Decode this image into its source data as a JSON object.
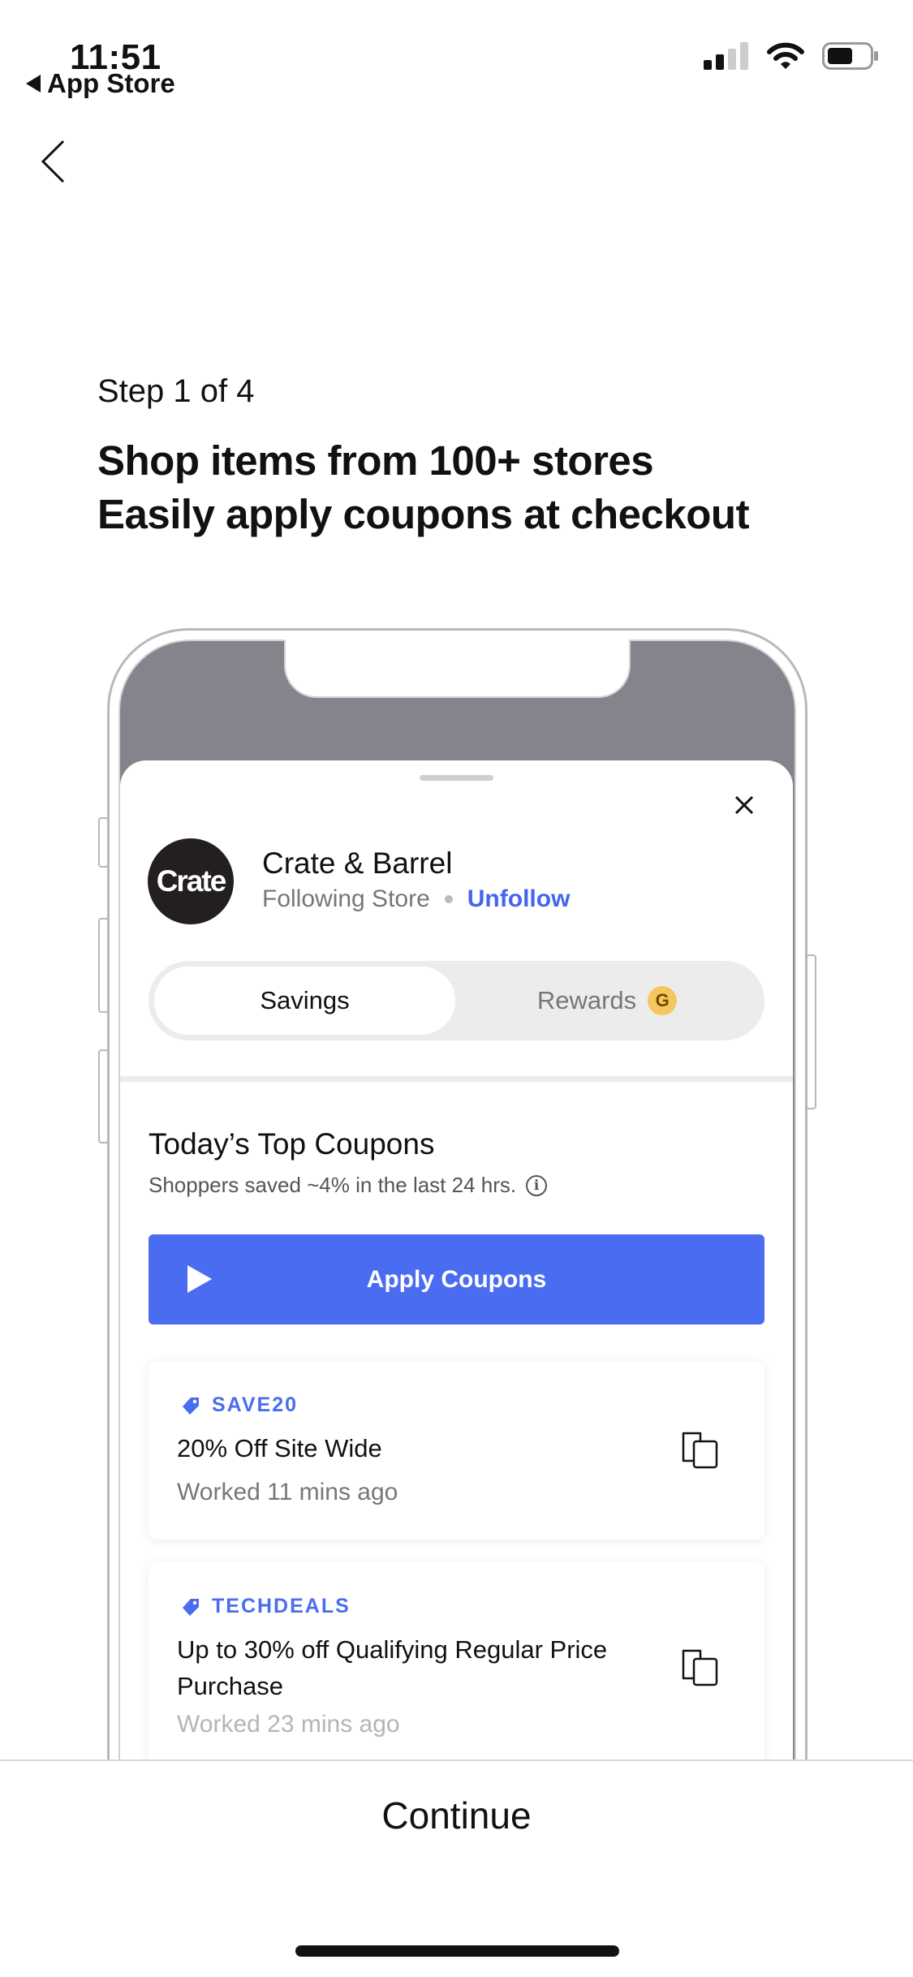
{
  "status_bar": {
    "time": "11:51",
    "back_app": "App Store",
    "battery_level": 0.55
  },
  "nav": {
    "back_icon": "chevron-left-icon"
  },
  "onboarding": {
    "step": "Step 1 of 4",
    "headline": [
      "Shop items from 100+ stores",
      "Easily apply coupons at checkout"
    ],
    "continue_label": "Continue"
  },
  "mock": {
    "store": {
      "logo_text": "Crate",
      "name": "Crate & Barrel",
      "status": "Following Store",
      "action": "Unfollow"
    },
    "tabs": [
      {
        "label": "Savings",
        "selected": true
      },
      {
        "label": "Rewards",
        "badge": "G"
      }
    ],
    "section": {
      "title": "Today’s Top Coupons",
      "subtitle": "Shoppers saved ~4% in the last 24 hrs.",
      "info": "i"
    },
    "apply_label": "Apply Coupons",
    "coupons": [
      {
        "code": "SAVE20",
        "title": "20% Off Site Wide",
        "meta": "Worked 11 mins ago"
      },
      {
        "code": "TECHDEALS",
        "title": "Up to 30% off Qualifying Regular Price Purchase",
        "meta": "Worked 23 mins ago"
      }
    ],
    "accent": "#4a6cf0"
  }
}
